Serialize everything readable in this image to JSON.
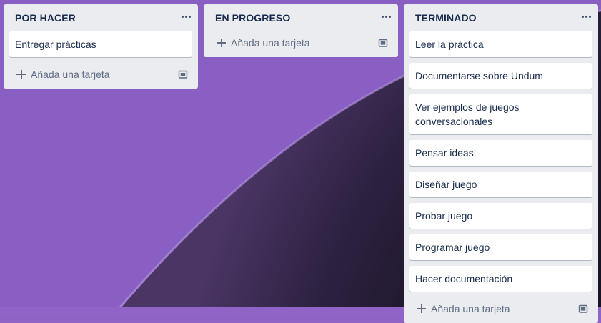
{
  "board": {
    "lists": [
      {
        "title": "POR HACER",
        "cards": [
          "Entregar prácticas"
        ],
        "add_label": "Añada una tarjeta"
      },
      {
        "title": "EN PROGRESO",
        "cards": [],
        "add_label": "Añada una tarjeta"
      },
      {
        "title": "TERMINADO",
        "cards": [
          "Leer la práctica",
          "Documentarse sobre Undum",
          "Ver ejemplos de juegos conversacionales",
          "Pensar ideas",
          "Diseñar juego",
          "Probar juego",
          "Programar juego",
          "Hacer documentación"
        ],
        "add_label": "Añada una tarjeta"
      }
    ]
  },
  "icons": {
    "menu": "more-horizontal-icon",
    "add": "plus-icon",
    "template": "card-template-icon"
  },
  "colors": {
    "list_bg": "#ebecf0",
    "card_bg": "#ffffff",
    "text": "#172b4d",
    "muted": "#5e6c84",
    "background": "#8558bd"
  }
}
